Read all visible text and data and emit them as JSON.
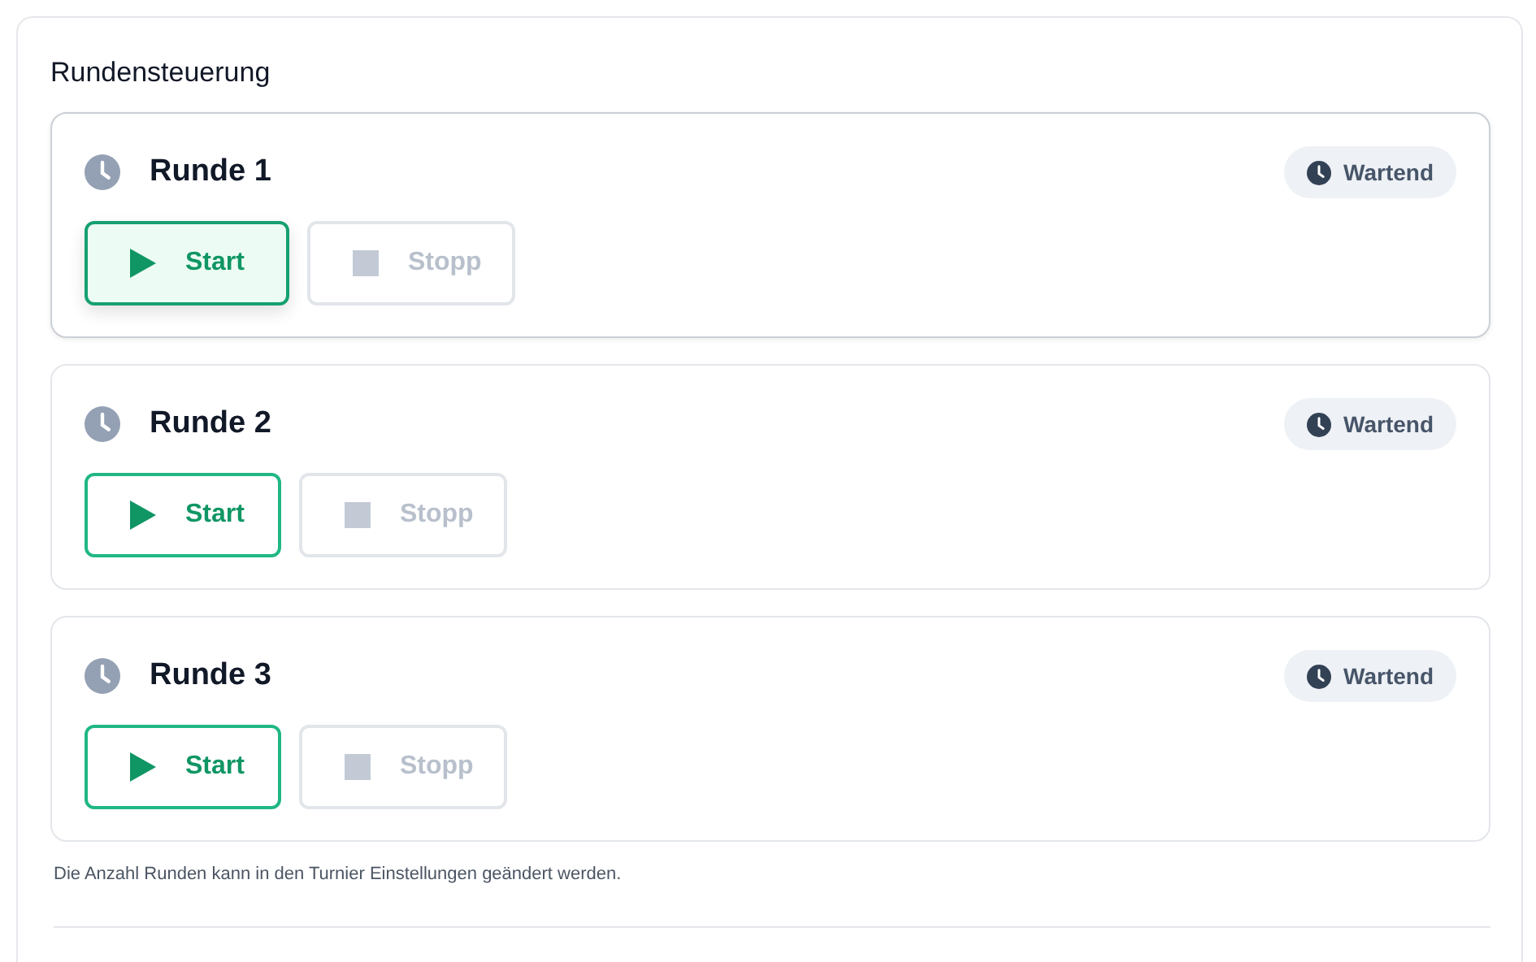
{
  "panel": {
    "title": "Rundensteuerung",
    "rounds": [
      {
        "name": "Runde 1",
        "status": "Wartend",
        "hovered": true,
        "start": {
          "label": "Start",
          "hovered": true,
          "disabled": false
        },
        "stop": {
          "label": "Stopp",
          "disabled": true
        }
      },
      {
        "name": "Runde 2",
        "status": "Wartend",
        "hovered": false,
        "start": {
          "label": "Start",
          "hovered": false,
          "disabled": false
        },
        "stop": {
          "label": "Stopp",
          "disabled": true
        }
      },
      {
        "name": "Runde 3",
        "status": "Wartend",
        "hovered": false,
        "start": {
          "label": "Start",
          "hovered": false,
          "disabled": false
        },
        "stop": {
          "label": "Stopp",
          "disabled": true
        }
      }
    ],
    "note": "Die Anzahl Runden kann in den Turnier Einstellungen geändert werden."
  }
}
